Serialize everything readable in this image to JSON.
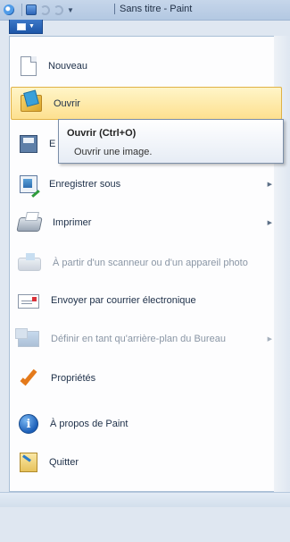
{
  "window": {
    "title": "Sans titre - Paint"
  },
  "quick_access": [
    {
      "icon": "paint-app-icon"
    },
    {
      "icon": "save-icon"
    },
    {
      "icon": "undo-icon"
    },
    {
      "icon": "redo-icon"
    }
  ],
  "file_button": {
    "icon": "paint-menu-icon"
  },
  "menu": {
    "items": [
      {
        "label": "Nouveau",
        "icon": "new-document-icon",
        "enabled": true
      },
      {
        "label": "Ouvrir",
        "icon": "open-folder-icon",
        "enabled": true,
        "highlighted": true
      },
      {
        "label": "E",
        "icon": "floppy-save-icon",
        "enabled": true
      },
      {
        "label": "Enregistrer sous",
        "icon": "save-as-icon",
        "enabled": true,
        "submenu": true
      },
      {
        "label": "Imprimer",
        "icon": "printer-icon",
        "enabled": true,
        "submenu": true
      },
      {
        "label": "À partir d'un scanneur ou d'un appareil photo",
        "icon": "scanner-icon",
        "enabled": false
      },
      {
        "label": "Envoyer par courrier électronique",
        "icon": "email-icon",
        "enabled": true
      },
      {
        "label": "Définir en tant qu'arrière-plan du Bureau",
        "icon": "desktop-background-icon",
        "enabled": false,
        "submenu": true
      },
      {
        "label": "Propriétés",
        "icon": "checkmark-icon",
        "enabled": true
      },
      {
        "label": "À propos de Paint",
        "icon": "info-icon",
        "enabled": true
      },
      {
        "label": "Quitter",
        "icon": "exit-icon",
        "enabled": true
      }
    ]
  },
  "tooltip": {
    "title": "Ouvrir (Ctrl+O)",
    "description": "Ouvrir une image."
  },
  "colors": {
    "highlight_top": "#fff5c8",
    "highlight_bottom": "#fde08f",
    "file_button": "#1d56a8"
  }
}
